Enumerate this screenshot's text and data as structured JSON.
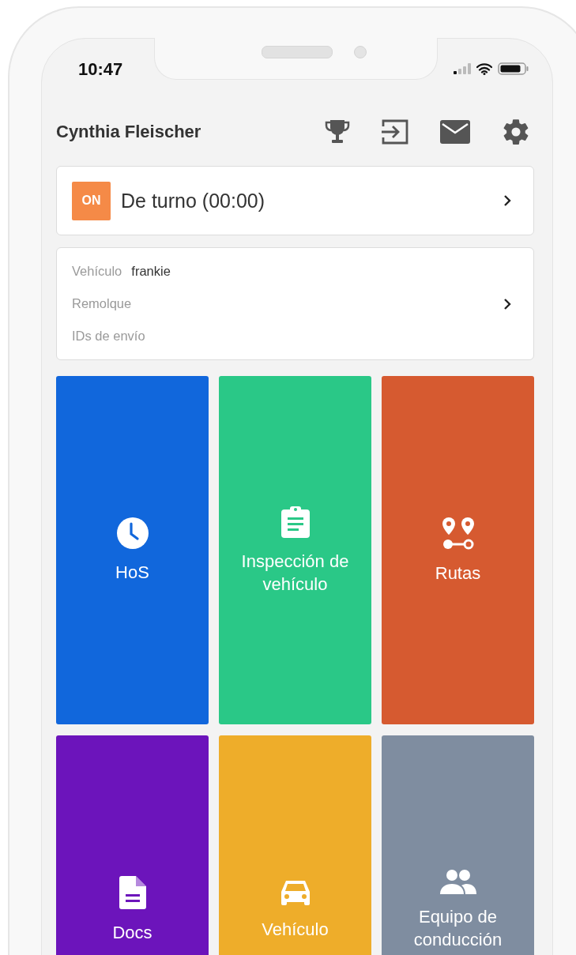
{
  "status_bar": {
    "time": "10:47"
  },
  "header": {
    "user_name": "Cynthia Fleischer"
  },
  "duty_status": {
    "badge": "ON",
    "label": "De turno (00:00)"
  },
  "assignment": {
    "fields": [
      {
        "label": "Vehículo",
        "value": "frankie"
      },
      {
        "label": "Remolque"
      },
      {
        "label": "IDs de envío"
      }
    ]
  },
  "tiles": [
    {
      "label": "HoS",
      "kind": "clock",
      "color": "#1167dc"
    },
    {
      "label": "Inspección de vehículo",
      "kind": "clipboard",
      "color": "#2ac887"
    },
    {
      "label": "Rutas",
      "kind": "route",
      "color": "#d65a30"
    },
    {
      "label": "Docs",
      "kind": "document",
      "color": "#6c14bb"
    },
    {
      "label": "Vehículo",
      "kind": "car",
      "color": "#eead2a"
    },
    {
      "label": "Equipo de conducción",
      "kind": "people",
      "color": "#7f8da0"
    }
  ]
}
